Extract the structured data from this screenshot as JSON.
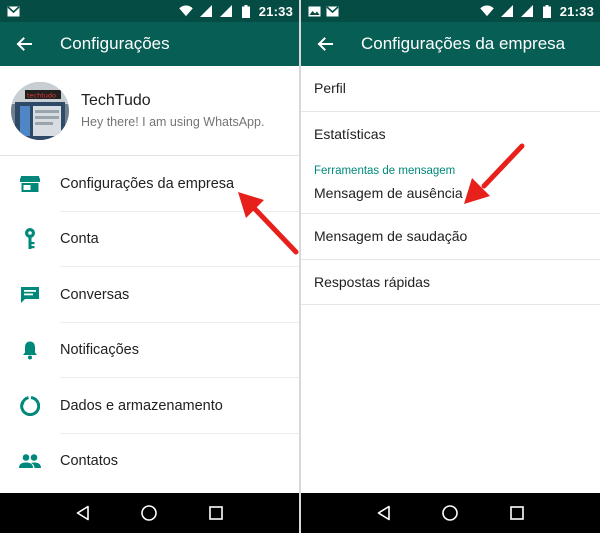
{
  "status_bar": {
    "time": "21:33",
    "left_icons": [
      "gmail-icon"
    ],
    "right_icons": [
      "wifi-icon",
      "signal-icon",
      "signal-icon",
      "battery-icon"
    ],
    "right_screen_left_icons": [
      "image-icon",
      "gmail-icon"
    ]
  },
  "left_screen": {
    "title": "Configurações",
    "profile": {
      "name": "TechTudo",
      "status": "Hey there! I am using WhatsApp.",
      "avatar_text": "techtudo"
    },
    "items": [
      {
        "label": "Configurações da empresa",
        "icon": "store-icon"
      },
      {
        "label": "Conta",
        "icon": "key-icon"
      },
      {
        "label": "Conversas",
        "icon": "chat-icon"
      },
      {
        "label": "Notificações",
        "icon": "bell-icon"
      },
      {
        "label": "Dados e armazenamento",
        "icon": "data-usage-icon"
      },
      {
        "label": "Contatos",
        "icon": "contacts-icon"
      }
    ]
  },
  "right_screen": {
    "title": "Configurações da empresa",
    "items": [
      {
        "label": "Perfil"
      },
      {
        "label": "Estatísticas"
      }
    ],
    "section_header": "Ferramentas de mensagem",
    "message_items": [
      {
        "label": "Mensagem de ausência"
      },
      {
        "label": "Mensagem de saudação"
      },
      {
        "label": "Respostas rápidas"
      }
    ]
  },
  "colors": {
    "statusbar": "#054d44",
    "appbar": "#075e54",
    "accent": "#00897b",
    "arrow": "#e8201c"
  }
}
